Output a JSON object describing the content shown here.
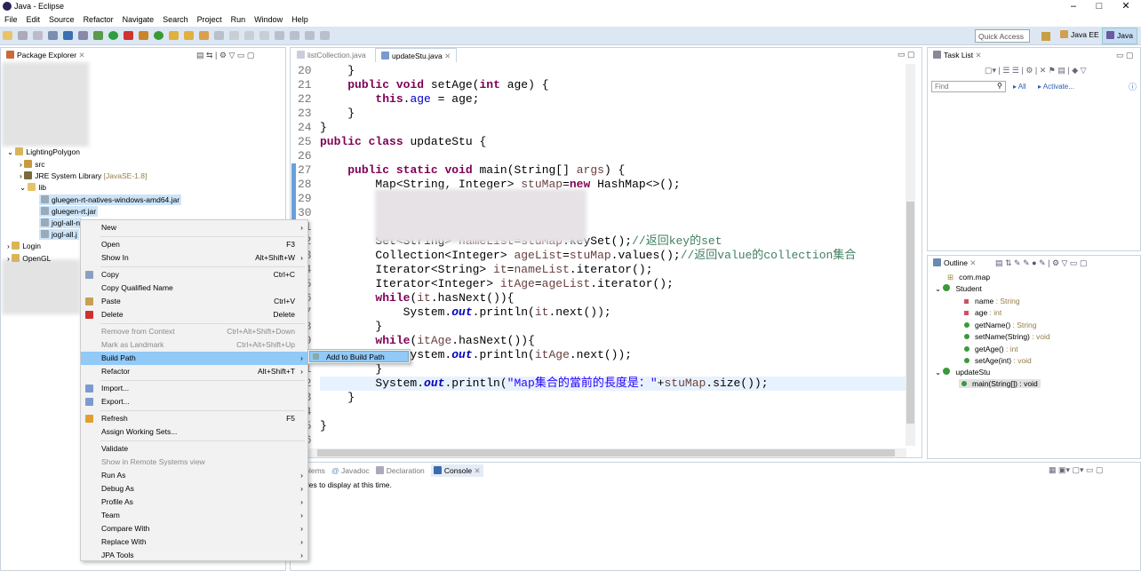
{
  "window": {
    "title": "Java - Eclipse"
  },
  "menubar": [
    "File",
    "Edit",
    "Source",
    "Refactor",
    "Navigate",
    "Search",
    "Project",
    "Run",
    "Window",
    "Help"
  ],
  "toolbar": {
    "quick_access": "Quick Access",
    "perspectives": [
      "Java EE",
      "Java"
    ]
  },
  "package_explorer": {
    "title": "Package Explorer",
    "tree": [
      {
        "label": "LightingPolygon",
        "expanded": true
      },
      {
        "label": "src"
      },
      {
        "label": "JRE System Library",
        "decoration": "[JavaSE-1.8]"
      },
      {
        "label": "lib",
        "expanded": true
      },
      {
        "label": "gluegen-rt-natives-windows-amd64.jar",
        "selected": true
      },
      {
        "label": "gluegen-rt.jar",
        "selected": true
      },
      {
        "label": "jogl-all-n",
        "selected": true
      },
      {
        "label": "jogl-all.j",
        "selected": true
      },
      {
        "label": "Login"
      },
      {
        "label": "OpenGL"
      }
    ]
  },
  "editor": {
    "tabs": [
      "listCollection.java",
      "updateStu.java"
    ],
    "active_tab": 1,
    "lines": [
      {
        "n": "20",
        "code": "    }"
      },
      {
        "n": "21",
        "code": "    public void setAge(int age) {"
      },
      {
        "n": "22",
        "code": "        this.age = age;"
      },
      {
        "n": "23",
        "code": "    }"
      },
      {
        "n": "24",
        "code": "}"
      },
      {
        "n": "25",
        "code": "public class updateStu {"
      },
      {
        "n": "26",
        "code": ""
      },
      {
        "n": "27",
        "code": "    public static void main(String[] args) {"
      },
      {
        "n": "28",
        "code": "        Map<String, Integer> stuMap=new HashMap<>();"
      },
      {
        "n": "29",
        "code": ""
      },
      {
        "n": "30",
        "code": ""
      },
      {
        "n": "31",
        "code": ""
      },
      {
        "n": "32",
        "code": "        Set<String> nameList=stuMap.keySet();//返回key的set"
      },
      {
        "n": "33",
        "code": "        Collection<Integer> ageList=stuMap.values();//返回value的collection集合"
      },
      {
        "n": "34",
        "code": "        Iterator<String> it=nameList.iterator();"
      },
      {
        "n": "35",
        "code": "        Iterator<Integer> itAge=ageList.iterator();"
      },
      {
        "n": "36",
        "code": "        while(it.hasNext()){"
      },
      {
        "n": "37",
        "code": "            System.out.println(it.next());"
      },
      {
        "n": "38",
        "code": "        }"
      },
      {
        "n": "39",
        "code": "        while(itAge.hasNext()){"
      },
      {
        "n": "40",
        "code": "            System.out.println(itAge.next());"
      },
      {
        "n": "41",
        "code": "        }"
      },
      {
        "n": "42",
        "code": "        System.out.println(\"Map集合的當前的長度是：\"+stuMap.size());"
      },
      {
        "n": "43",
        "code": "    }"
      },
      {
        "n": "44",
        "code": ""
      },
      {
        "n": "45",
        "code": "}"
      },
      {
        "n": "46",
        "code": ""
      }
    ]
  },
  "task_list": {
    "title": "Task List",
    "find_placeholder": "Find",
    "all": "All",
    "activate": "Activate..."
  },
  "outline": {
    "title": "Outline",
    "items": [
      {
        "label": "com.map",
        "type": ""
      },
      {
        "label": "Student",
        "type": ""
      },
      {
        "label": "name",
        "type": " : String"
      },
      {
        "label": "age",
        "type": " : int"
      },
      {
        "label": "getName()",
        "type": " : String"
      },
      {
        "label": "setName(String)",
        "type": " : void"
      },
      {
        "label": "getAge()",
        "type": " : int"
      },
      {
        "label": "setAge(int)",
        "type": " : void"
      },
      {
        "label": "updateStu",
        "type": ""
      },
      {
        "label": "main(String[]) : void",
        "type": ""
      }
    ]
  },
  "bottom": {
    "tabs": [
      "Problems",
      "Javadoc",
      "Declaration",
      "Console"
    ],
    "active_tab": 3,
    "message": "No consoles to display at this time."
  },
  "context_menu": {
    "items": [
      {
        "label": "New",
        "shortcut": "",
        "submenu": true
      },
      {
        "label": "Open",
        "shortcut": "F3"
      },
      {
        "label": "Show In",
        "shortcut": "Alt+Shift+W",
        "submenu": true
      },
      {
        "label": "Copy",
        "shortcut": "Ctrl+C"
      },
      {
        "label": "Copy Qualified Name",
        "shortcut": ""
      },
      {
        "label": "Paste",
        "shortcut": "Ctrl+V"
      },
      {
        "label": "Delete",
        "shortcut": "Delete"
      },
      {
        "label": "Remove from Context",
        "shortcut": "Ctrl+Alt+Shift+Down",
        "disabled": true
      },
      {
        "label": "Mark as Landmark",
        "shortcut": "Ctrl+Alt+Shift+Up",
        "disabled": true
      },
      {
        "label": "Build Path",
        "shortcut": "",
        "submenu": true,
        "highlighted": true
      },
      {
        "label": "Refactor",
        "shortcut": "Alt+Shift+T",
        "submenu": true
      },
      {
        "label": "Import...",
        "shortcut": ""
      },
      {
        "label": "Export...",
        "shortcut": ""
      },
      {
        "label": "Refresh",
        "shortcut": "F5"
      },
      {
        "label": "Assign Working Sets...",
        "shortcut": ""
      },
      {
        "label": "Validate",
        "shortcut": ""
      },
      {
        "label": "Show in Remote Systems view",
        "shortcut": "",
        "disabled": true
      },
      {
        "label": "Run As",
        "shortcut": "",
        "submenu": true
      },
      {
        "label": "Debug As",
        "shortcut": "",
        "submenu": true
      },
      {
        "label": "Profile As",
        "shortcut": "",
        "submenu": true
      },
      {
        "label": "Team",
        "shortcut": "",
        "submenu": true
      },
      {
        "label": "Compare With",
        "shortcut": "",
        "submenu": true
      },
      {
        "label": "Replace With",
        "shortcut": "",
        "submenu": true
      },
      {
        "label": "JPA Tools",
        "shortcut": "",
        "submenu": true
      }
    ],
    "submenu": {
      "label": "Add to Build Path"
    }
  },
  "colors": {
    "toolbar": "#dce7f3",
    "selection": "#91c9f7",
    "keyword": "#7f0055",
    "comment": "#3f7f5f",
    "string": "#2a00ff"
  }
}
